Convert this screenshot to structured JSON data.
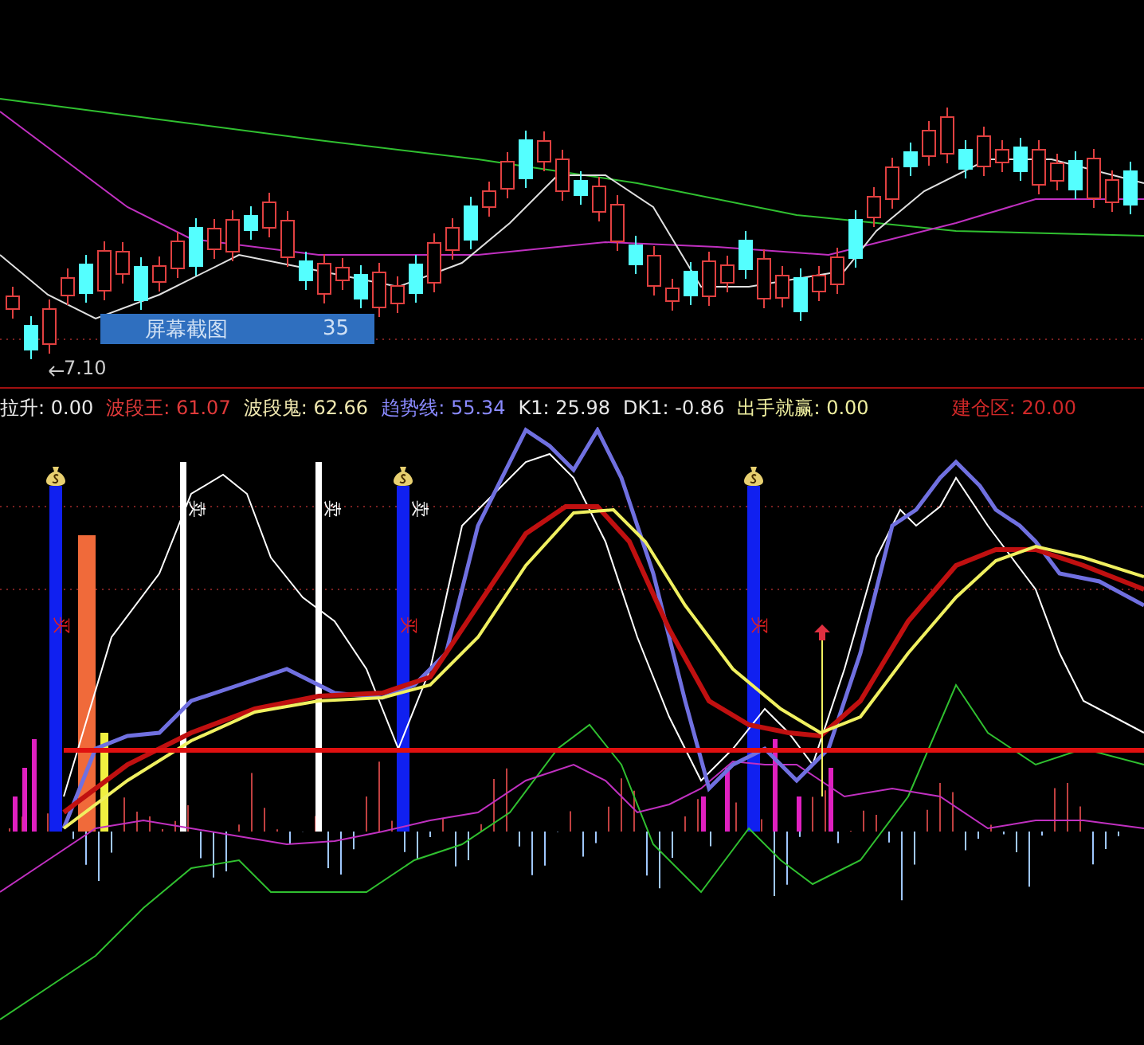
{
  "price_panel": {
    "low_price_label": "7.10",
    "info_box": {
      "label": "屏幕截图",
      "value": "35"
    }
  },
  "indicator_values": [
    {
      "name": "拉升:",
      "value": "0.00",
      "color": "#e8e8e8"
    },
    {
      "name": "波段王:",
      "value": "61.07",
      "color": "#e03a3a"
    },
    {
      "name": "波段鬼:",
      "value": "62.66",
      "color": "#f0e8b0"
    },
    {
      "name": "趋势线:",
      "value": "55.34",
      "color": "#8a8aff"
    },
    {
      "name": "K1:",
      "value": "25.98",
      "color": "#e8e8e8"
    },
    {
      "name": "DK1:",
      "value": "-0.86",
      "color": "#e8e8e8"
    },
    {
      "name": "出手就赢:",
      "value": "0.00",
      "color": "#f0f0a0"
    },
    {
      "name": "建仓区:",
      "value": "20.00",
      "color": "#d02828"
    }
  ],
  "signals": [
    {
      "kind": "buy",
      "label": "买"
    },
    {
      "kind": "sell",
      "label": "卖"
    },
    {
      "kind": "sell",
      "label": "卖"
    },
    {
      "kind": "sell",
      "label": "卖"
    },
    {
      "kind": "buy",
      "label": "买"
    },
    {
      "kind": "buy",
      "label": "买"
    }
  ]
}
